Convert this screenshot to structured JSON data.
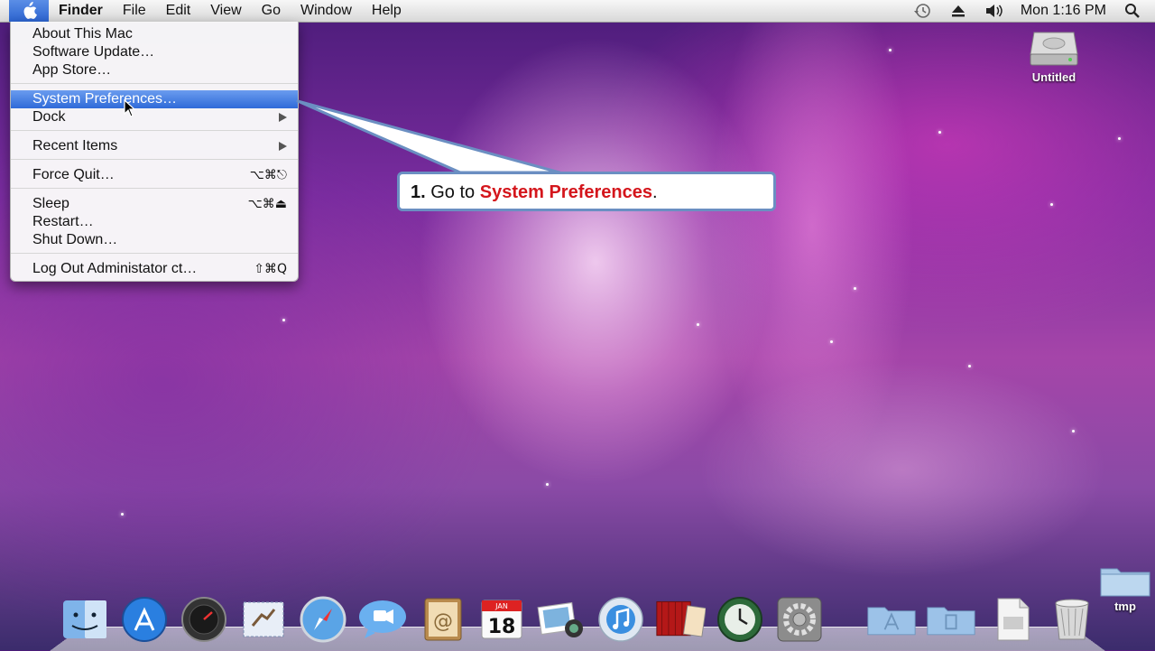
{
  "menubar": {
    "apple_icon": "apple-icon",
    "menus": [
      "Finder",
      "File",
      "Edit",
      "View",
      "Go",
      "Window",
      "Help"
    ],
    "clock": "Mon 1:16 PM",
    "status_icons": [
      "time-machine-icon",
      "eject-icon",
      "volume-icon",
      "spotlight-icon"
    ]
  },
  "apple_menu": {
    "items": [
      {
        "label": "About This Mac",
        "shortcut": ""
      },
      {
        "label": "Software Update…",
        "shortcut": ""
      },
      {
        "label": "App Store…",
        "shortcut": ""
      },
      {
        "label": "System Preferences…",
        "shortcut": "",
        "highlighted": true
      },
      {
        "label": "Dock",
        "submenu": true
      },
      {
        "label": "Recent Items",
        "submenu": true
      },
      {
        "label": "Force Quit…",
        "shortcut": "⌥⌘⎋"
      },
      {
        "label": "Sleep",
        "shortcut": "⌥⌘⏏"
      },
      {
        "label": "Restart…",
        "shortcut": ""
      },
      {
        "label": "Shut Down…",
        "shortcut": ""
      },
      {
        "label": "Log Out Administator ct…",
        "shortcut": "⇧⌘Q"
      }
    ]
  },
  "callout": {
    "step": "1.",
    "text_before": "Go to",
    "highlight": "System Preferences",
    "text_after": ".",
    "highlight_color": "#d4161c"
  },
  "desktop": {
    "hard_drive_label": "Untitled",
    "folder_label": "tmp"
  },
  "dock": {
    "items": [
      "finder-icon",
      "app-store-icon",
      "dashboard-icon",
      "mail-icon",
      "safari-icon",
      "ichat-icon",
      "address-book-icon",
      "ical-icon",
      "iphoto-icon",
      "itunes-icon",
      "front-row-icon",
      "time-machine-icon",
      "system-preferences-icon",
      "applications-stack-icon",
      "documents-stack-icon",
      "file-icon",
      "trash-icon"
    ],
    "ical_month": "JAN",
    "ical_day": "18"
  }
}
